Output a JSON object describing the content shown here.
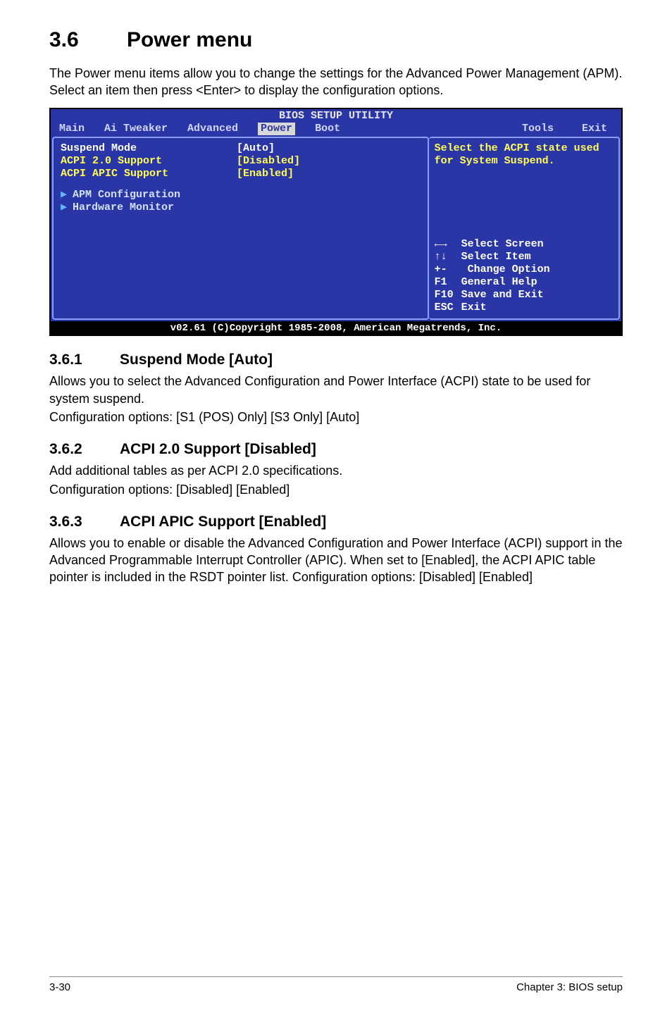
{
  "section": {
    "number": "3.6",
    "title": "Power menu",
    "intro": "The Power menu items allow you to change the settings for the Advanced Power Management (APM). Select an item then press <Enter> to display the configuration options."
  },
  "bios": {
    "title": "BIOS SETUP UTILITY",
    "menubar": [
      "Main",
      "Ai Tweaker",
      "Advanced",
      "Power",
      "Boot",
      "Tools",
      "Exit"
    ],
    "selected_tab": "Power",
    "items": [
      {
        "label": "Suspend Mode",
        "value": "[Auto]"
      },
      {
        "label": "ACPI 2.0 Support",
        "value": "[Disabled]"
      },
      {
        "label": "ACPI APIC Support",
        "value": "[Enabled]"
      }
    ],
    "submenus": [
      "APM Configuration",
      "Hardware Monitor"
    ],
    "help": "Select the ACPI state used for System Suspend.",
    "keys": [
      {
        "k": "←→",
        "d": "Select Screen"
      },
      {
        "k": "↑↓",
        "d": "Select Item"
      },
      {
        "k": "+-",
        "d": " Change Option"
      },
      {
        "k": "F1",
        "d": "General Help"
      },
      {
        "k": "F10",
        "d": "Save and Exit"
      },
      {
        "k": "ESC",
        "d": "Exit"
      }
    ],
    "footer": "v02.61 (C)Copyright 1985-2008, American Megatrends, Inc."
  },
  "subsections": [
    {
      "num": "3.6.1",
      "title": "Suspend Mode [Auto]",
      "paras": [
        "Allows you to select the Advanced Configuration and Power Interface (ACPI) state to be used for system suspend.",
        "Configuration options: [S1 (POS) Only] [S3 Only] [Auto]"
      ]
    },
    {
      "num": "3.6.2",
      "title": "ACPI 2.0 Support [Disabled]",
      "paras": [
        "Add additional tables as per ACPI 2.0 specifications.",
        "Configuration options: [Disabled] [Enabled]"
      ]
    },
    {
      "num": "3.6.3",
      "title": "ACPI APIC Support [Enabled]",
      "paras": [
        "Allows you to enable or disable the Advanced Configuration and Power Interface (ACPI) support in the Advanced Programmable Interrupt Controller (APIC). When set to [Enabled], the ACPI APIC table pointer is included in the RSDT pointer list. Configuration options: [Disabled] [Enabled]"
      ]
    }
  ],
  "footer": {
    "left": "3-30",
    "right": "Chapter 3: BIOS setup"
  }
}
